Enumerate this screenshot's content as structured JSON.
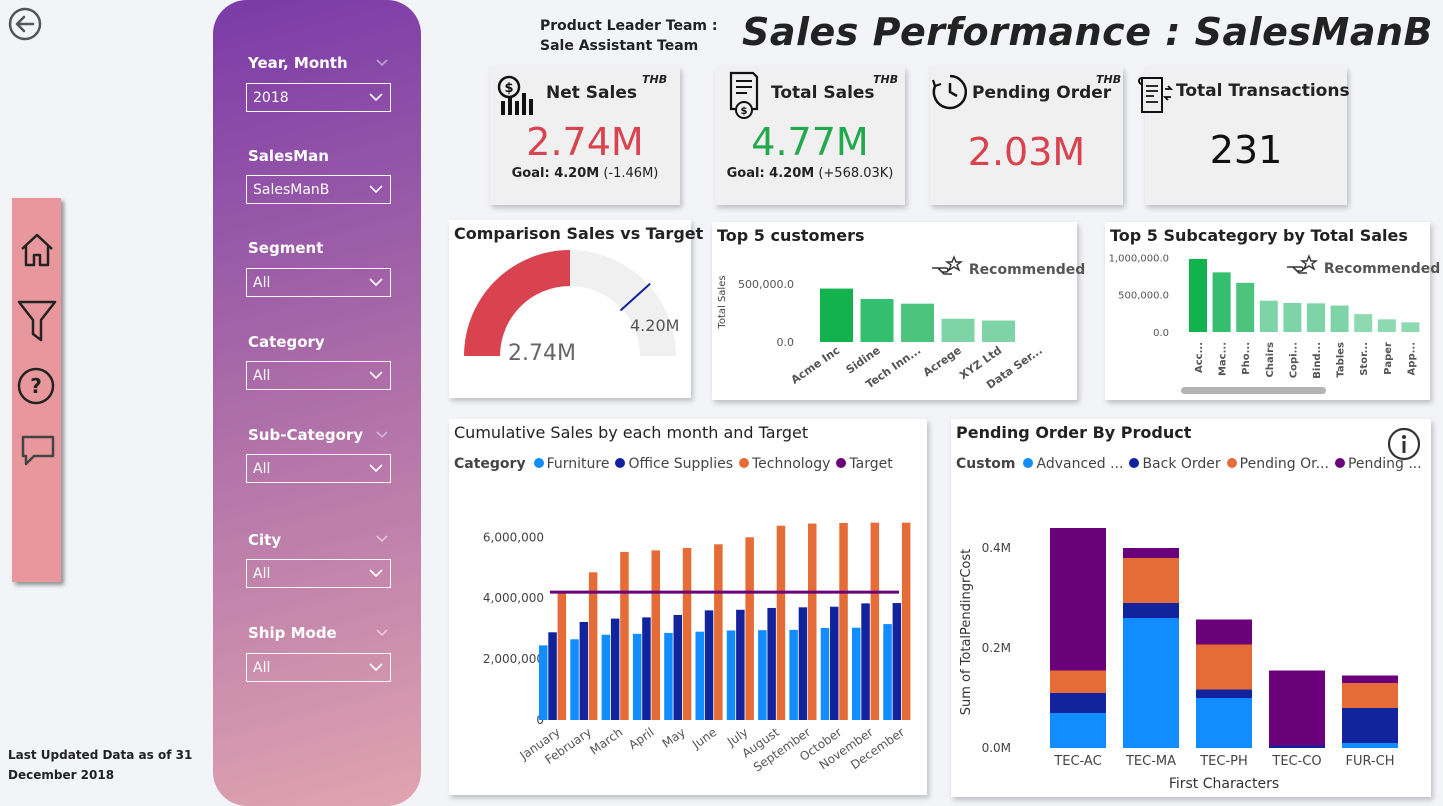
{
  "header": {
    "team_line1": "Product Leader Team :",
    "team_line2": "Sale Assistant Team",
    "title": "Sales Performance : SalesManB",
    "last_updated_line1": "Last Updated Data as of 31",
    "last_updated_line2": "December 2018"
  },
  "filters": {
    "year_month": {
      "label": "Year, Month",
      "value": "2018"
    },
    "salesman": {
      "label": "SalesMan",
      "value": "SalesManB"
    },
    "segment": {
      "label": "Segment",
      "value": "All"
    },
    "category": {
      "label": "Category",
      "value": "All"
    },
    "subcategory": {
      "label": "Sub-Category",
      "value": "All"
    },
    "city": {
      "label": "City",
      "value": "All"
    },
    "ship_mode": {
      "label": "Ship Mode",
      "value": "All"
    }
  },
  "kpis": {
    "net_sales": {
      "title": "Net Sales",
      "currency": "THB",
      "value": "2.74M",
      "goal_label": "Goal: 4.20M",
      "goal_delta": "(-1.46M)",
      "color": "#d9434f"
    },
    "total_sales": {
      "title": "Total Sales",
      "currency": "THB",
      "value": "4.77M",
      "goal_label": "Goal: 4.20M",
      "goal_delta": "(+568.03K)",
      "color": "#21a94b"
    },
    "pending_order": {
      "title": "Pending Order",
      "currency": "THB",
      "value": "2.03M",
      "color": "#d9434f"
    },
    "total_transactions": {
      "title": "Total Transactions",
      "value": "231"
    }
  },
  "gauge": {
    "title": "Comparison Sales vs Target",
    "value_label": "2.74M",
    "target_label": "4.20M",
    "value": 2.74,
    "target": 4.2,
    "max": 5.48,
    "color": "#d9434f"
  },
  "recommended_label": "Recommended",
  "chart_data": [
    {
      "type": "bar",
      "title": "Top 5 customers",
      "ylabel": "Total Sales",
      "yticks": [
        "500,000.0",
        "0.0"
      ],
      "ytick_values": [
        500000,
        0
      ],
      "ylim": [
        0,
        620000
      ],
      "categories": [
        "Acme Inc",
        "Sidine",
        "Tech Inn...",
        "Acrege",
        "XYZ Ltd",
        "Data Ser..."
      ],
      "values": [
        460000,
        370000,
        330000,
        200000,
        185000,
        0
      ],
      "colors": [
        "#12b24e",
        "#33bf6e",
        "#4cc47e",
        "#7ed4a6",
        "#7ed4a6",
        "#7ed4a6"
      ]
    },
    {
      "type": "bar",
      "title": "Top 5 Subcategory by Total Sales",
      "yticks": [
        "1,000,000.0",
        "500,000.0",
        "0.0"
      ],
      "ytick_values": [
        1000000,
        500000,
        0
      ],
      "ylim": [
        0,
        1100000
      ],
      "categories": [
        "Acc...",
        "Mac...",
        "Pho...",
        "Chairs",
        "Copi...",
        "Bind...",
        "Tables",
        "Stor...",
        "Paper",
        "App..."
      ],
      "values": [
        980000,
        800000,
        660000,
        420000,
        390000,
        385000,
        355000,
        240000,
        170000,
        130000
      ],
      "colors": [
        "#12b24e",
        "#33bf6e",
        "#4cc47e",
        "#7ed4a6",
        "#7ed4a6",
        "#7ed4a6",
        "#7ed4a6",
        "#8ddab1",
        "#8ddab1",
        "#8ddab1"
      ]
    },
    {
      "type": "bar",
      "title": "Cumulative Sales by each month and Target",
      "legend_title": "Category",
      "yticks": [
        "6,000,000",
        "4,000,000",
        "2,000,000",
        "0"
      ],
      "ytick_values": [
        6000000,
        4000000,
        2000000,
        0
      ],
      "ylim": [
        0,
        6600000
      ],
      "categories": [
        "January",
        "February",
        "March",
        "April",
        "May",
        "June",
        "July",
        "August",
        "September",
        "October",
        "November",
        "December"
      ],
      "series": [
        {
          "name": "Furniture",
          "color": "#118dff",
          "values": [
            2450000,
            2650000,
            2800000,
            2830000,
            2860000,
            2900000,
            2940000,
            2950000,
            2960000,
            3020000,
            3030000,
            3150000
          ]
        },
        {
          "name": "Office Supplies",
          "color": "#12239e",
          "values": [
            2880000,
            3220000,
            3330000,
            3370000,
            3450000,
            3600000,
            3620000,
            3680000,
            3700000,
            3720000,
            3830000,
            3840000
          ]
        },
        {
          "name": "Technology",
          "color": "#e66c37",
          "values": [
            4200000,
            4850000,
            5520000,
            5570000,
            5650000,
            5770000,
            6000000,
            6380000,
            6450000,
            6470000,
            6480000,
            6480000
          ]
        }
      ],
      "target": {
        "name": "Target",
        "color": "#6b007b",
        "value": 4200000
      }
    },
    {
      "type": "bar",
      "title": "Pending Order By Product",
      "legend_title": "Custom",
      "xlabel": "First Characters",
      "ylabel": "Sum of TotalPendingrCost",
      "yticks": [
        "0.4M",
        "0.2M",
        "0.0M"
      ],
      "ytick_values": [
        0.4,
        0.2,
        0
      ],
      "ylim": [
        0,
        0.46
      ],
      "categories": [
        "TEC-AC",
        "TEC-MA",
        "TEC-PH",
        "TEC-CO",
        "FUR-CH"
      ],
      "series": [
        {
          "name": "Advanced ...",
          "color": "#118dff",
          "values": [
            0.07,
            0.26,
            0.1,
            0.0,
            0.01
          ]
        },
        {
          "name": "Back Order",
          "color": "#12239e",
          "values": [
            0.04,
            0.03,
            0.017,
            0.005,
            0.07
          ]
        },
        {
          "name": "Pending Or...",
          "color": "#e66c37",
          "values": [
            0.045,
            0.09,
            0.09,
            0.0,
            0.05
          ]
        },
        {
          "name": "Pending ...",
          "color": "#6b007b",
          "values": [
            0.285,
            0.02,
            0.05,
            0.15,
            0.015
          ]
        }
      ]
    }
  ]
}
